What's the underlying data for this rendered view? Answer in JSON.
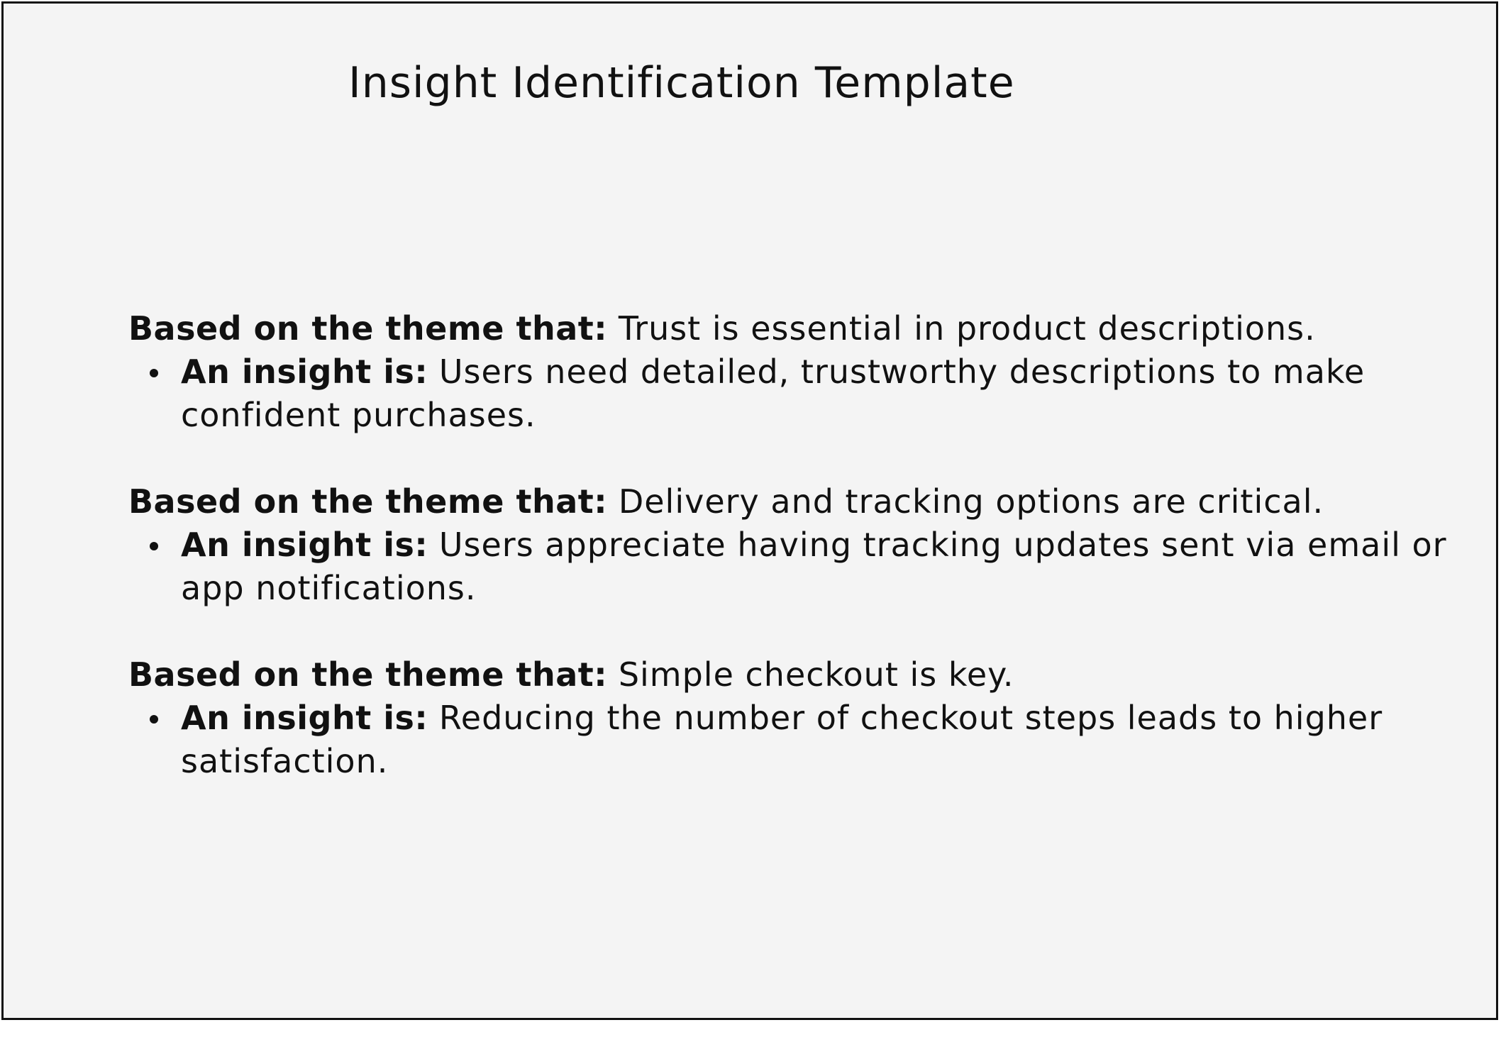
{
  "document": {
    "title": "Insight Identification Template",
    "blocks": [
      {
        "theme_label": "Based on the theme that:",
        "theme_text": "Trust is essential in product descriptions.",
        "insight_label": "An insight is:",
        "insight_text": "Users need detailed, trustworthy descriptions to make confident purchases."
      },
      {
        "theme_label": "Based on the theme that:",
        "theme_text": "Delivery and tracking options are critical.",
        "insight_label": "An insight is:",
        "insight_text": "Users appreciate having tracking updates sent via email or app notifications."
      },
      {
        "theme_label": "Based on the theme that:",
        "theme_text": "Simple checkout is key.",
        "insight_label": "An insight is:",
        "insight_text": "Reducing the number of checkout steps leads to higher satisfaction."
      }
    ]
  },
  "colors": {
    "background": "#f4f4f4",
    "border": "#111111",
    "text": "#111111"
  }
}
